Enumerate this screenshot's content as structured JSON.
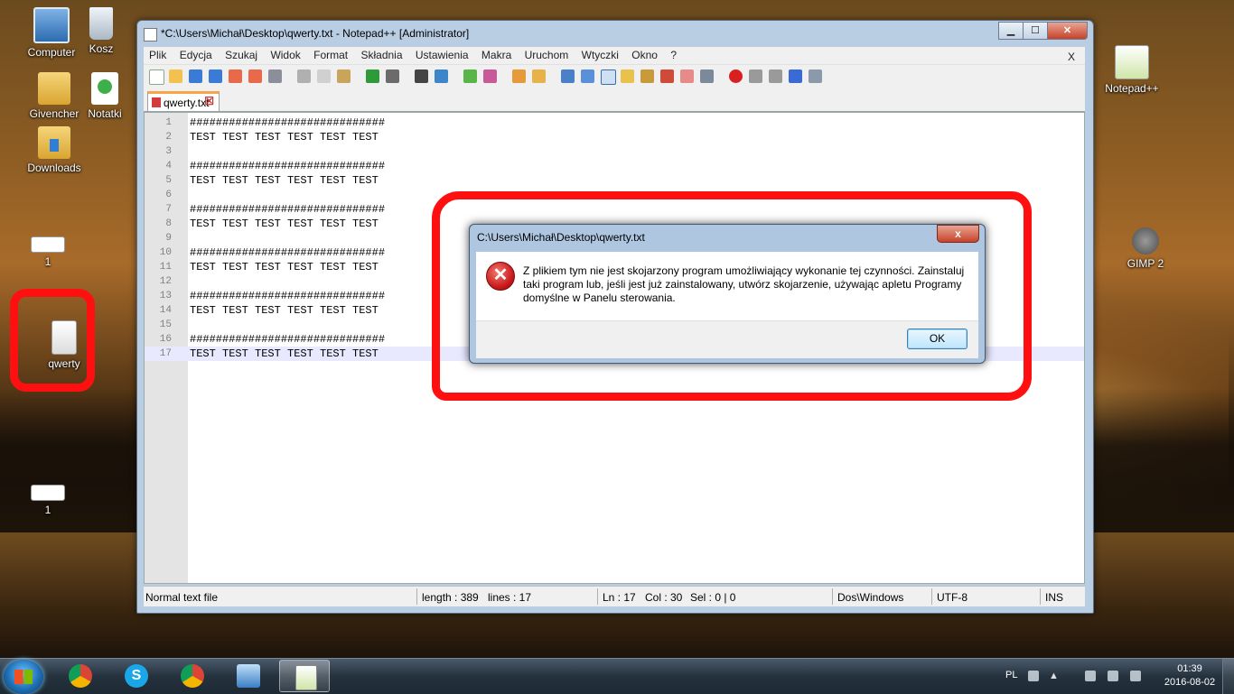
{
  "desktop": {
    "icons": [
      {
        "label": "Computer"
      },
      {
        "label": "Kosz"
      },
      {
        "label": "Givencher"
      },
      {
        "label": "Notatki"
      },
      {
        "label": "Downloads"
      },
      {
        "label": "1"
      },
      {
        "label": "qwerty"
      },
      {
        "label": "1"
      },
      {
        "label": "Notepad++"
      },
      {
        "label": "GIMP 2"
      }
    ]
  },
  "window": {
    "title": "*C:\\Users\\Michał\\Desktop\\qwerty.txt - Notepad++ [Administrator]",
    "menu": [
      "Plik",
      "Edycja",
      "Szukaj",
      "Widok",
      "Format",
      "Składnia",
      "Ustawienia",
      "Makra",
      "Uruchom",
      "Wtyczki",
      "Okno",
      "?"
    ],
    "menu_close": "X",
    "tab_label": "qwerty.txt",
    "lines": [
      {
        "n": "1",
        "t": "##############################"
      },
      {
        "n": "2",
        "t": "TEST TEST TEST TEST TEST TEST"
      },
      {
        "n": "3",
        "t": ""
      },
      {
        "n": "4",
        "t": "##############################"
      },
      {
        "n": "5",
        "t": "TEST TEST TEST TEST TEST TEST"
      },
      {
        "n": "6",
        "t": ""
      },
      {
        "n": "7",
        "t": "##############################"
      },
      {
        "n": "8",
        "t": "TEST TEST TEST TEST TEST TEST"
      },
      {
        "n": "9",
        "t": ""
      },
      {
        "n": "10",
        "t": "##############################"
      },
      {
        "n": "11",
        "t": "TEST TEST TEST TEST TEST TEST"
      },
      {
        "n": "12",
        "t": ""
      },
      {
        "n": "13",
        "t": "##############################"
      },
      {
        "n": "14",
        "t": "TEST TEST TEST TEST TEST TEST"
      },
      {
        "n": "15",
        "t": ""
      },
      {
        "n": "16",
        "t": "##############################"
      },
      {
        "n": "17",
        "t": "TEST TEST TEST TEST TEST TEST"
      }
    ],
    "status": {
      "filetype": "Normal text file",
      "length": "length : 389",
      "lines": "lines : 17",
      "ln": "Ln : 17",
      "col": "Col : 30",
      "sel": "Sel : 0 | 0",
      "eol": "Dos\\Windows",
      "encoding": "UTF-8",
      "mode": "INS"
    }
  },
  "dialog": {
    "title": "C:\\Users\\Michał\\Desktop\\qwerty.txt",
    "close": "x",
    "message": "Z plikiem tym nie jest skojarzony program umożliwiający wykonanie tej czynności. Zainstaluj taki program lub, jeśli jest już zainstalowany, utwórz skojarzenie, używając apletu Programy domyślne w Panelu sterowania.",
    "ok": "OK"
  },
  "taskbar": {
    "language": "PL",
    "time": "01:39",
    "date": "2016-08-02"
  },
  "colors": {
    "annotation": "#ff1010",
    "current_line": "#e8e8ff"
  }
}
